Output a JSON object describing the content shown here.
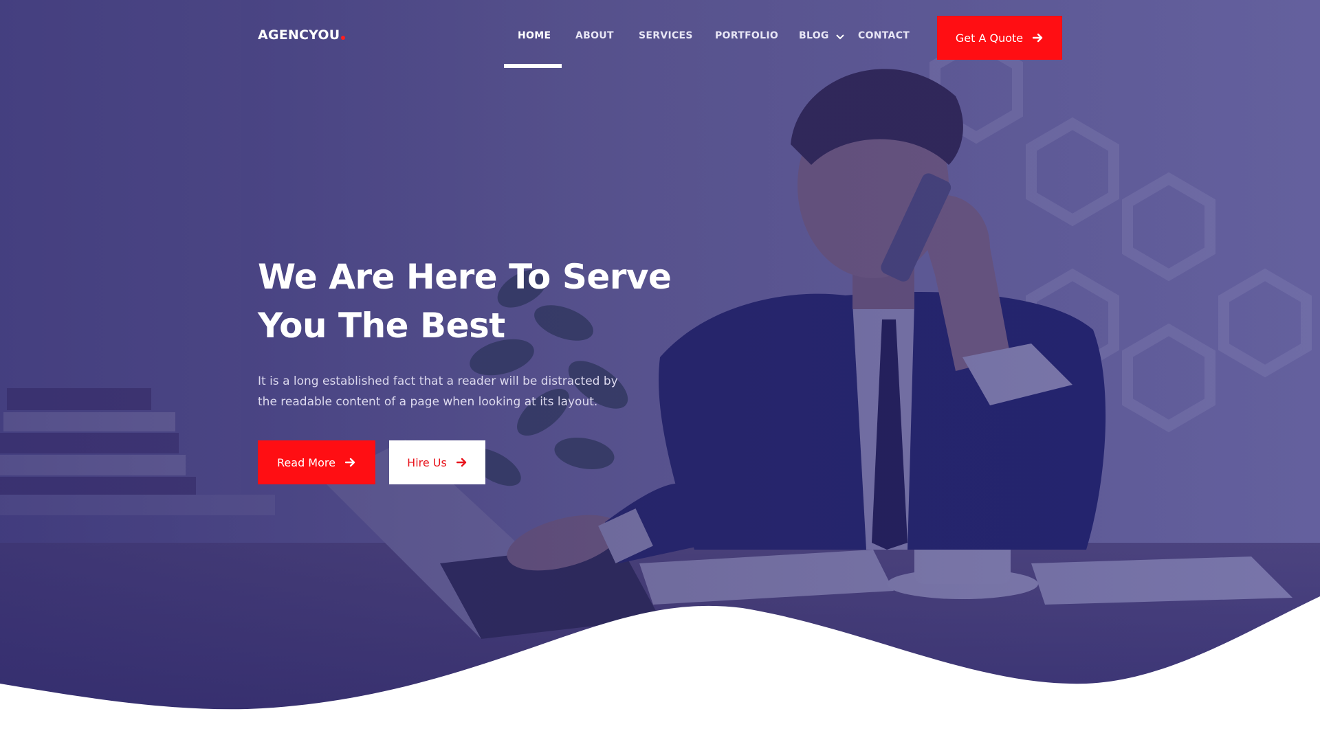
{
  "header": {
    "logo": "AGENCYOU",
    "nav": [
      {
        "label": "HOME",
        "active": true
      },
      {
        "label": "ABOUT",
        "active": false
      },
      {
        "label": "SERVICES",
        "active": false
      },
      {
        "label": "PORTFOLIO",
        "active": false
      },
      {
        "label": "BLOG",
        "active": false,
        "has_dropdown": true
      },
      {
        "label": "CONTACT",
        "active": false
      }
    ],
    "cta": {
      "label": "Get A Quote",
      "icon": "arrow-right-icon"
    }
  },
  "hero": {
    "headline_lines": [
      "We Are Here To Serve",
      "You The Best"
    ],
    "lead_lines": [
      "It is a long established fact that a reader will be distracted by",
      "the readable content of a page when looking at its layout."
    ],
    "primary_button": {
      "label": "Read More",
      "icon": "arrow-right-icon"
    },
    "secondary_button": {
      "label": "Hire Us",
      "icon": "arrow-right-icon"
    }
  },
  "colors": {
    "accent": "#ff0e13",
    "overlay": "#2c266e",
    "text": "#ffffff"
  }
}
